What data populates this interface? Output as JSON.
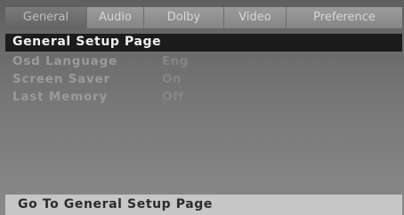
{
  "tabs": [
    {
      "label": "General"
    },
    {
      "label": "Audio"
    },
    {
      "label": "Dolby"
    },
    {
      "label": "Video"
    },
    {
      "label": "Preference"
    }
  ],
  "page": {
    "title": "General Setup Page"
  },
  "settings": [
    {
      "label": "Osd Language",
      "value": "Eng"
    },
    {
      "label": "Screen Saver",
      "value": "On"
    },
    {
      "label": "Last Memory",
      "value": "Off"
    }
  ],
  "status": {
    "text": "Go To General Setup Page"
  },
  "colors": {
    "title_bar": "#1c1c1c",
    "status_bar": "#c6c6c6"
  }
}
